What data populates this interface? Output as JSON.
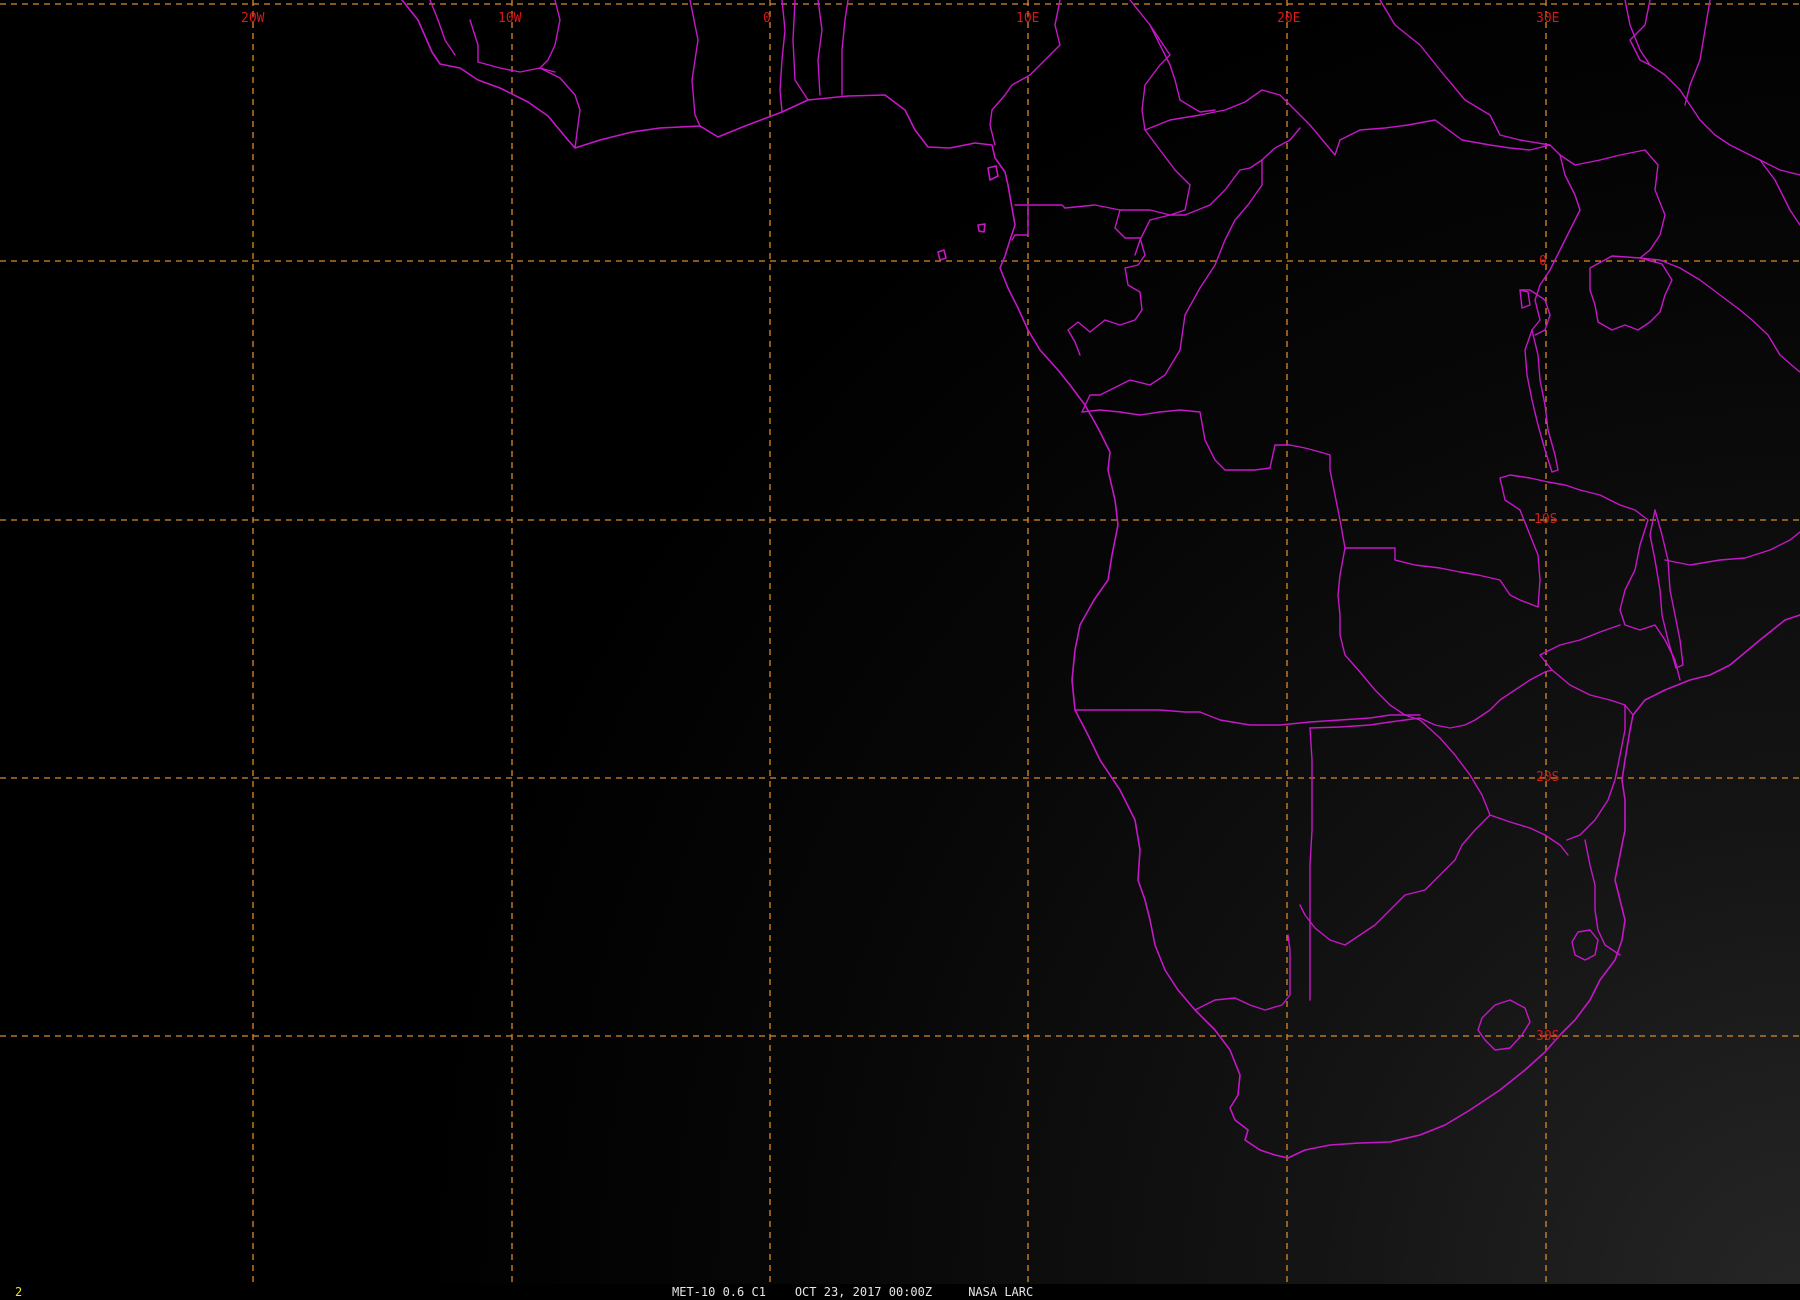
{
  "map": {
    "grid_labels": {
      "longitude": [
        "20W",
        "10W",
        "0",
        "10E",
        "20E",
        "30E"
      ],
      "latitude": [
        "0",
        "10S",
        "20S",
        "30S"
      ]
    },
    "colors": {
      "background": "#000000",
      "graticule": "#d9892a",
      "grid_label": "#d41a1a",
      "boundaries": "#c617c8",
      "frame_number": "#e8e23a",
      "caption": "#e6e6e6"
    }
  },
  "status_bar": {
    "frame_number": "2",
    "caption": "MET-10 0.6 C1    OCT 23, 2017 00:00Z     NASA LARC"
  }
}
